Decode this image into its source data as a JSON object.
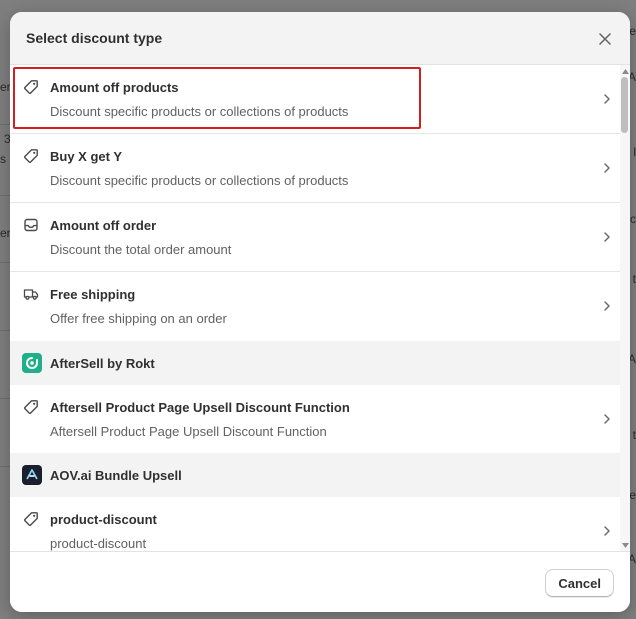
{
  "background": {
    "left_fragments": [
      "er",
      "3",
      "s",
      "er"
    ],
    "right_fragments": [
      "e",
      "A",
      "l",
      "c",
      "t",
      "A",
      "t",
      "e",
      "A"
    ]
  },
  "modal": {
    "title": "Select discount type",
    "close_icon": "close-icon",
    "cancel_label": "Cancel"
  },
  "items": [
    {
      "title": "Amount off products",
      "description": "Discount specific products or collections of products",
      "icon": "tag-icon"
    },
    {
      "title": "Buy X get Y",
      "description": "Discount specific products or collections of products",
      "icon": "tag-icon"
    },
    {
      "title": "Amount off order",
      "description": "Discount the total order amount",
      "icon": "inbox-icon"
    },
    {
      "title": "Free shipping",
      "description": "Offer free shipping on an order",
      "icon": "truck-icon"
    }
  ],
  "groups": [
    {
      "title": "AfterSell by Rokt",
      "logo_color": "#1fb08a",
      "items": [
        {
          "title": "Aftersell Product Page Upsell Discount Function",
          "description": "Aftersell Product Page Upsell Discount Function",
          "icon": "tag-icon"
        }
      ]
    },
    {
      "title": "AOV.ai Bundle Upsell",
      "logo_color": "#1a1f2e",
      "items": [
        {
          "title": "product-discount",
          "description": "product-discount",
          "icon": "tag-icon"
        }
      ]
    }
  ],
  "colors": {
    "highlight": "#d4201c",
    "header_bg": "#f3f3f3"
  }
}
